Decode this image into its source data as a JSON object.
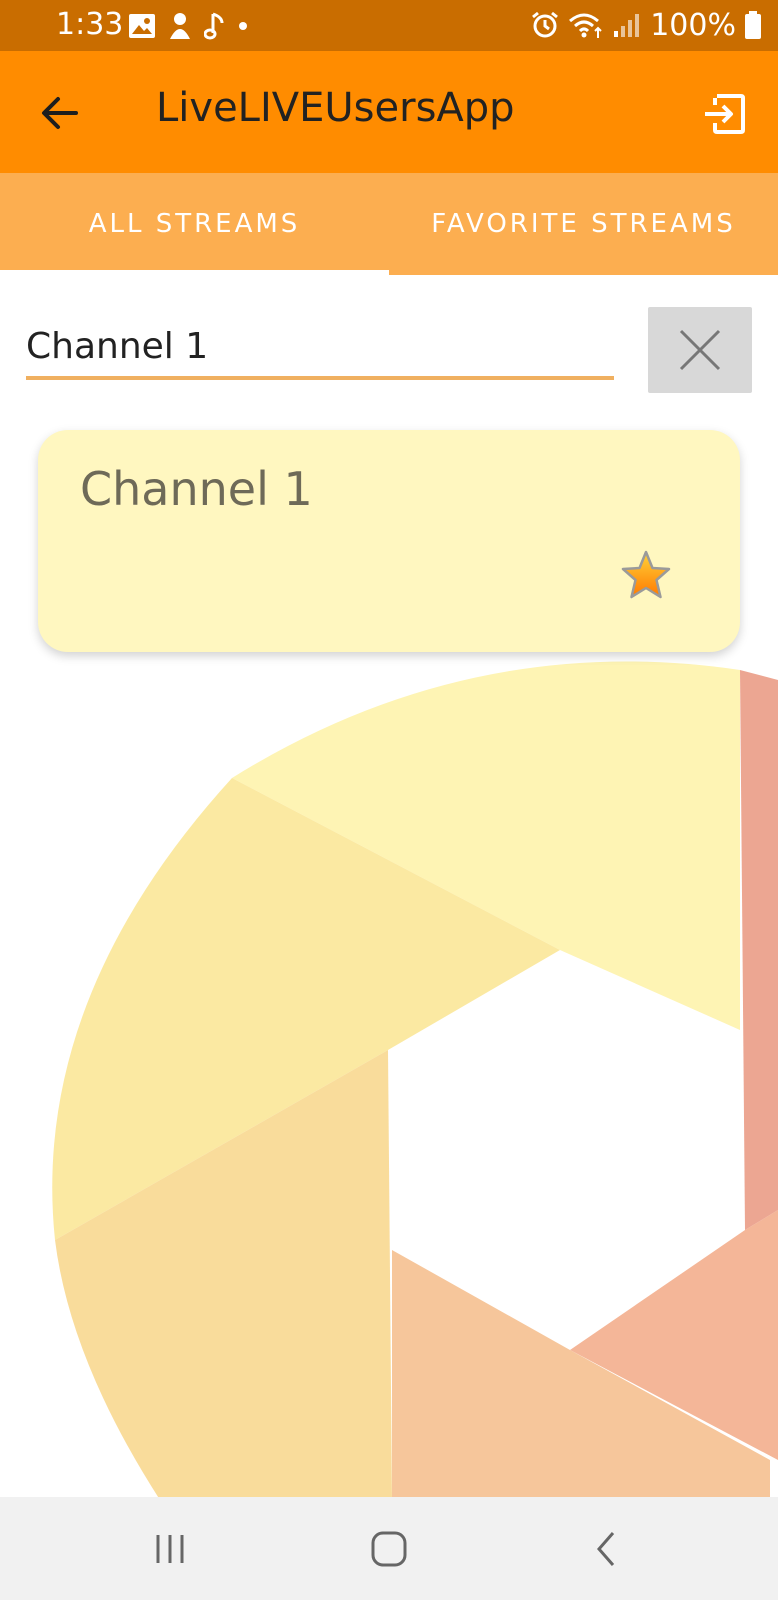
{
  "status_bar": {
    "time": "1:33",
    "battery": "100%",
    "left_icons": [
      "image-icon",
      "tools-icon",
      "music-note-icon",
      "dot-icon"
    ],
    "right_icons": [
      "alarm-icon",
      "wifi-icon",
      "signal-icon",
      "battery-icon"
    ]
  },
  "app_bar": {
    "title": "LiveLIVEUsersApp",
    "back_icon": "arrow-left-icon",
    "exit_icon": "exit-icon"
  },
  "tabs": [
    {
      "label": "ALL STREAMS",
      "selected": true
    },
    {
      "label": "FAVORITE STREAMS",
      "selected": false
    }
  ],
  "search": {
    "value": "Channel 1",
    "clear_icon": "close-icon"
  },
  "streams": [
    {
      "name": "Channel 1",
      "favorite": true,
      "favorite_icon": "star-icon"
    }
  ],
  "nav_bar": {
    "recents_icon": "recents-icon",
    "home_icon": "home-icon",
    "back_icon": "nav-back-icon"
  },
  "colors": {
    "status_bar": "#c96d00",
    "app_bar": "#ff8c00",
    "tab_bar": "#fcae50",
    "card": "#fff7c0",
    "search_underline": "#f0b060"
  }
}
